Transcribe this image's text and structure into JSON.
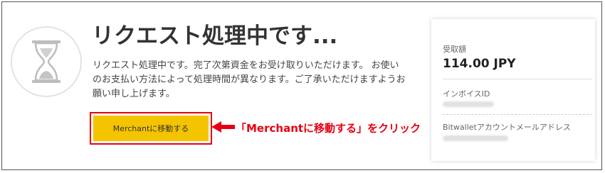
{
  "request": {
    "title": "リクエスト処理中です...",
    "description": "リクエスト処理中です。完了次第資金をお受け取りいただけます。 お使いのお支払い方法によって処理時間が異なります。ご了承いただけますようお願い申し上げます。",
    "merchant_button_label": "Merchantに移動する"
  },
  "annotation": {
    "text": "「Merchantに移動する」をクリック",
    "color": "#e60012"
  },
  "summary_card": {
    "received_amount_label": "受取額",
    "received_amount_value": "114.00 JPY",
    "invoice_id_label": "インボイスID",
    "bitwallet_email_label": "Bitwalletアカウントメールアドレス"
  },
  "colors": {
    "button": "#f5c400",
    "highlight": "#e60012"
  },
  "icons": [
    "hourglass-icon",
    "arrow-left-icon"
  ]
}
